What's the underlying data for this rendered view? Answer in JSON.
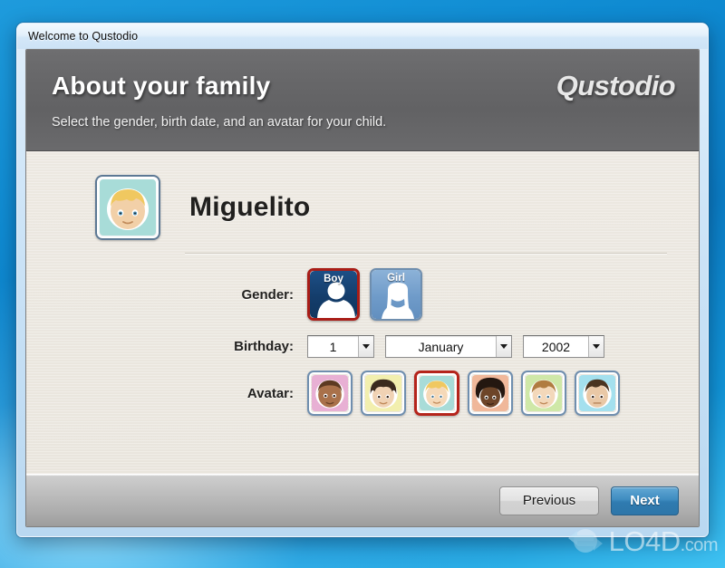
{
  "window": {
    "title": "Welcome to Qustodio"
  },
  "header": {
    "title": "About your family",
    "subtitle": "Select the gender, birth date, and an avatar for your child.",
    "brand": "Qustodio"
  },
  "profile": {
    "name": "Miguelito",
    "avatar_bg": "#a8dcd8",
    "avatar_hair": "#f0c860",
    "avatar_skin": "#f2d0a8"
  },
  "form": {
    "gender": {
      "label": "Gender:",
      "selected": "Boy",
      "options": [
        {
          "label": "Boy",
          "selected": true,
          "color": "#143d6b"
        },
        {
          "label": "Girl",
          "selected": false,
          "color": "#6f9bc9"
        }
      ]
    },
    "birthday": {
      "label": "Birthday:",
      "day": "1",
      "month": "January",
      "year": "2002"
    },
    "avatar": {
      "label": "Avatar:",
      "selected_index": 2,
      "options": [
        {
          "bg": "#e8b0d4",
          "hair": "#7a4a28",
          "skin": "#a9714a",
          "style": "short",
          "selected": false
        },
        {
          "bg": "#f2efae",
          "hair": "#3b2a1e",
          "skin": "#f0d2b4",
          "style": "curly",
          "selected": false
        },
        {
          "bg": "#a8dcd8",
          "hair": "#f0c860",
          "skin": "#f5d9b8",
          "style": "short",
          "selected": true
        },
        {
          "bg": "#f0b89a",
          "hair": "#241710",
          "skin": "#6d4529",
          "style": "afro",
          "selected": false
        },
        {
          "bg": "#cfe8a8",
          "hair": "#b07c40",
          "skin": "#f3d8ba",
          "style": "short",
          "selected": false
        },
        {
          "bg": "#a4e0ee",
          "hair": "#4a3420",
          "skin": "#e9c8a6",
          "style": "short",
          "selected": false
        }
      ]
    }
  },
  "footer": {
    "previous_label": "Previous",
    "next_label": "Next"
  },
  "watermark": {
    "text": "LO4D",
    "domain": ".com"
  },
  "colors": {
    "accent_red": "#b5241b",
    "accent_blue": "#3e8cc0",
    "header_gray": "#666668",
    "content_bg": "#ece8e1"
  }
}
